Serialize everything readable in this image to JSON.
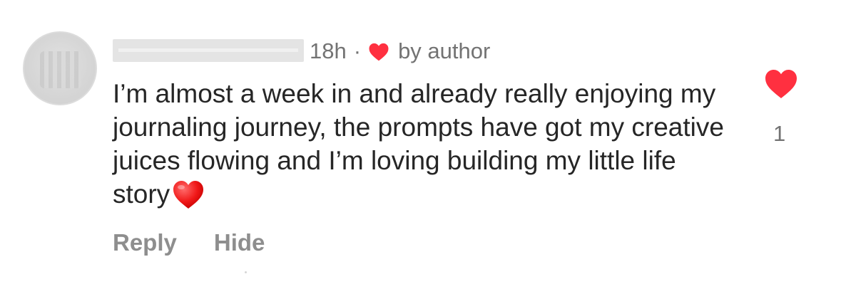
{
  "comment": {
    "time_ago": "18h",
    "separator": "·",
    "liked_by_label": "by author",
    "text": "I’m almost a week in and already really enjoying my journaling journey, the prompts have got my creative juices flowing and I’m loving building my little life story",
    "trailing_emoji": "red-heart-emoji"
  },
  "actions": {
    "reply_label": "Reply",
    "hide_label": "Hide"
  },
  "likes": {
    "count": "1",
    "liked": true,
    "heart_icon": "filled-heart-icon"
  },
  "colors": {
    "heart_red": "#ff3040",
    "meta_gray": "#737373",
    "action_gray": "#8e8e8e",
    "text_dark": "#262626"
  }
}
